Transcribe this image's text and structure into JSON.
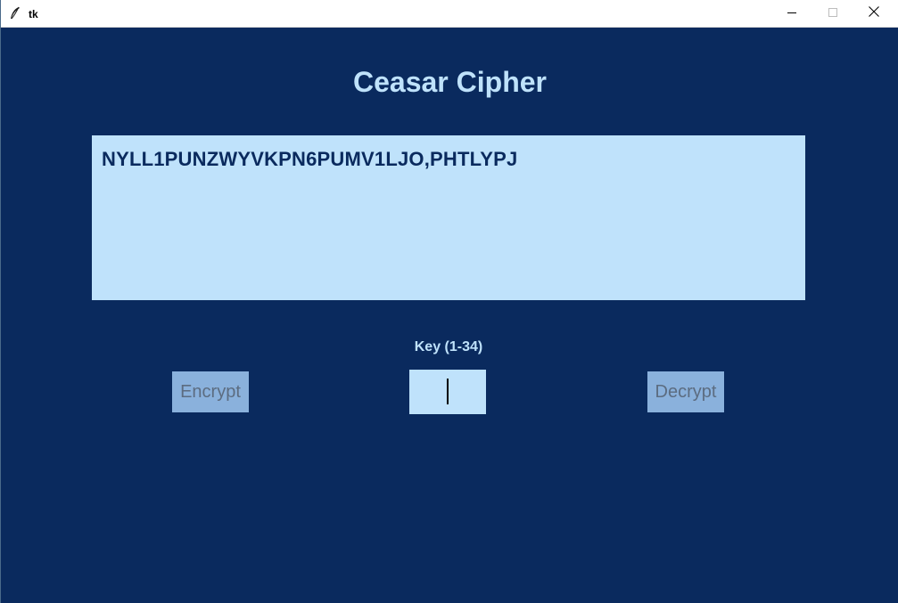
{
  "window": {
    "title": "tk",
    "icon": "feather-icon",
    "controls": [
      "minimize-icon",
      "maximize-icon",
      "close-icon"
    ]
  },
  "app": {
    "heading": "Ceasar Cipher",
    "text_area_value": "NYLL1PUNZWYVKPN6PUMV1LJO,PHTLYPJ",
    "key_label": "Key (1-34)",
    "key_value": "",
    "encrypt_label": "Encrypt",
    "decrypt_label": "Decrypt"
  },
  "colors": {
    "background": "#0a2a5e",
    "light_blue": "#bfe2fb",
    "button_bg": "#8ab1dc",
    "button_text": "#5c6c80"
  }
}
